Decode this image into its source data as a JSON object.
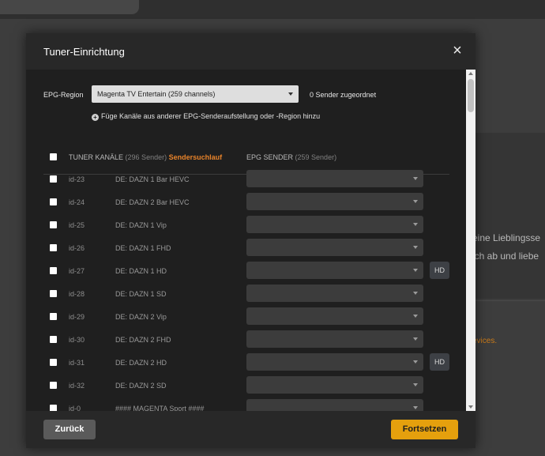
{
  "background": {
    "text_1": "eine Lieblingsse",
    "text_2": "ich ab und liebe",
    "link_text": "evices."
  },
  "modal": {
    "title": "Tuner-Einrichtung",
    "close_icon": "close-icon",
    "epg_region_label": "EPG-Region",
    "epg_region_value": "Magenta TV Entertain (259 channels)",
    "assigned_count": "0 Sender zugeordnet",
    "add_link": "Füge Kanäle aus anderer EPG-Senderaufstellung oder -Region hinzu",
    "table": {
      "tuner_header": "TUNER KANÄLE",
      "tuner_count": "(296 Sender)",
      "scan_link": "Sendersuchlauf",
      "epg_header": "EPG SENDER",
      "epg_count": "(259 Sender)"
    },
    "rows": [
      {
        "id": "id-23",
        "name": "DE: DAZN 1 Bar HEVC",
        "hd": ""
      },
      {
        "id": "id-24",
        "name": "DE: DAZN 2 Bar HEVC",
        "hd": ""
      },
      {
        "id": "id-25",
        "name": "DE: DAZN 1 Vip",
        "hd": ""
      },
      {
        "id": "id-26",
        "name": "DE: DAZN 1 FHD",
        "hd": ""
      },
      {
        "id": "id-27",
        "name": "DE: DAZN 1 HD",
        "hd": "HD"
      },
      {
        "id": "id-28",
        "name": "DE: DAZN 1 SD",
        "hd": ""
      },
      {
        "id": "id-29",
        "name": "DE: DAZN 2 Vip",
        "hd": ""
      },
      {
        "id": "id-30",
        "name": "DE: DAZN 2 FHD",
        "hd": ""
      },
      {
        "id": "id-31",
        "name": "DE: DAZN 2 HD",
        "hd": "HD"
      },
      {
        "id": "id-32",
        "name": "DE: DAZN 2 SD",
        "hd": ""
      },
      {
        "id": "id-0",
        "name": "#### MAGENTA Sport ####",
        "hd": ""
      }
    ],
    "footer": {
      "back_label": "Zurück",
      "continue_label": "Fortsetzen"
    }
  },
  "colors": {
    "accent": "#e5a00d",
    "scan_link": "#e8832a"
  }
}
